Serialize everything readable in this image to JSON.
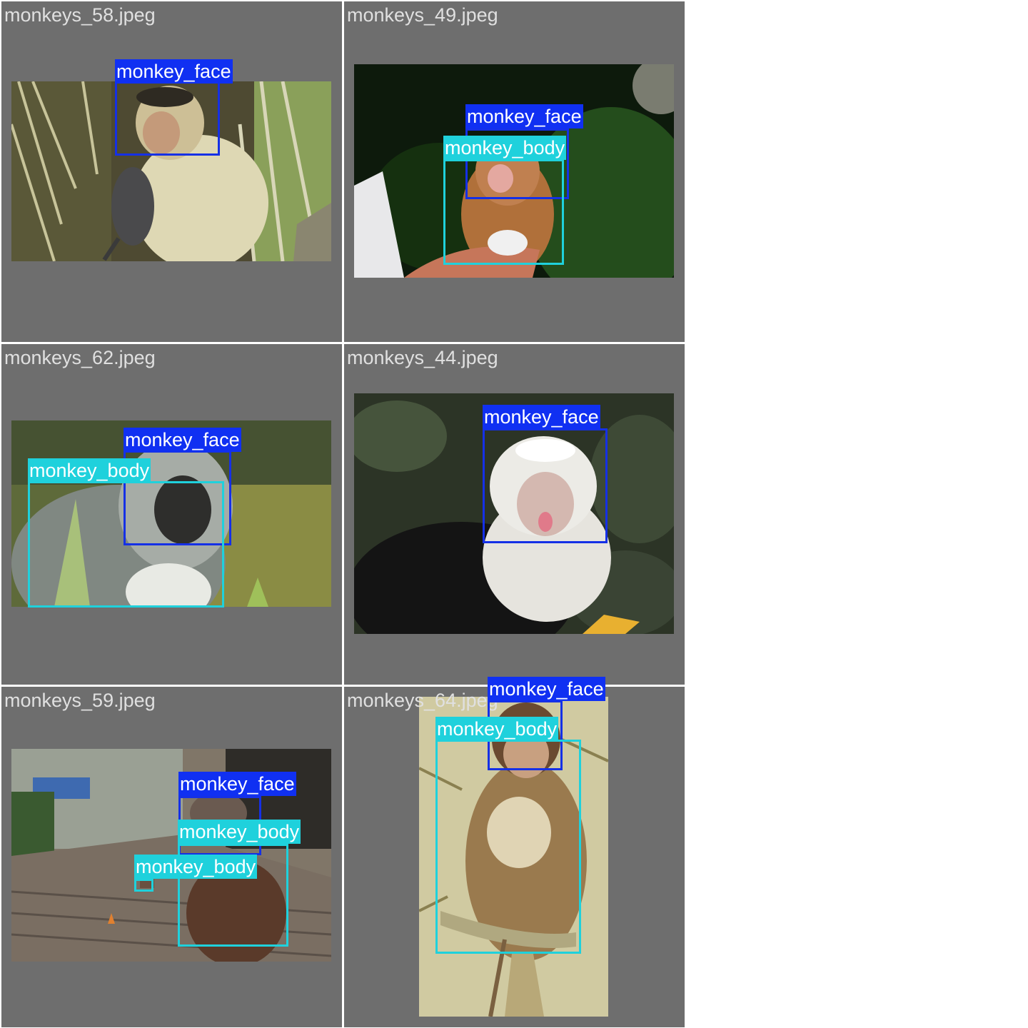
{
  "colors": {
    "panel_bg": "#6e6e6e",
    "face_class": "#1030f2",
    "body_class": "#1fd1dc"
  },
  "class_names": {
    "face": "monkey_face",
    "body": "monkey_body"
  },
  "panels": [
    {
      "filename": "monkeys_58.jpeg",
      "photo": "monkey with grey rat, leafy background"
    },
    {
      "filename": "monkeys_49.jpeg",
      "photo": "baby monkey held by a hand"
    },
    {
      "filename": "monkeys_62.jpeg",
      "photo": "grey vervet monkey in grass"
    },
    {
      "filename": "monkeys_44.jpeg",
      "photo": "white-faced capuchin showing tongue"
    },
    {
      "filename": "monkeys_59.jpeg",
      "photo": "macaque on temple stairs"
    },
    {
      "filename": "monkeys_64.jpeg",
      "photo": "macaque sitting on a branch"
    }
  ],
  "annotations": [
    [
      {
        "label": "monkey_face"
      }
    ],
    [
      {
        "label": "monkey_face"
      },
      {
        "label": "monkey_body"
      }
    ],
    [
      {
        "label": "monkey_face"
      },
      {
        "label": "monkey_body"
      }
    ],
    [
      {
        "label": "monkey_face"
      }
    ],
    [
      {
        "label": "monkey_face"
      },
      {
        "label": "monkey_body"
      },
      {
        "label": "monkey_body"
      }
    ],
    [
      {
        "label": "monkey_face"
      },
      {
        "label": "monkey_body"
      }
    ]
  ]
}
